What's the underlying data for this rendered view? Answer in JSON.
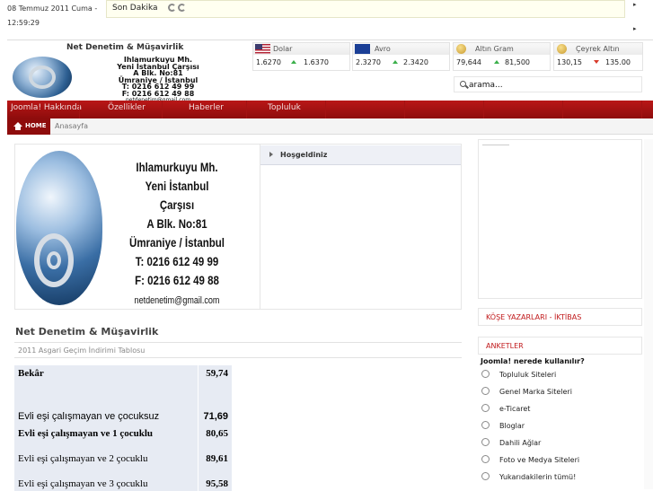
{
  "header": {
    "date": "08 Temmuz 2011 Cuma - 12:59:29",
    "news_label": "Son Dakika",
    "logo_title": "Net Denetim & Müşavirlik",
    "logo_lines": [
      "Ihlamurkuyu Mh.",
      "Yeni İstanbul Çarşısı",
      "A Blk. No:81",
      "Ümraniye / İstanbul",
      "T: 0216 612 49 99",
      "F: 0216 612 49 88",
      "netdenetim@gmail.com"
    ]
  },
  "currency": [
    {
      "name": "Dolar",
      "buy": "1.6270",
      "sell": "1.6370",
      "trend": "up",
      "icon": "us-flag-icon"
    },
    {
      "name": "Avro",
      "buy": "2.3270",
      "sell": "2.3420",
      "trend": "up",
      "icon": "eu-flag-icon"
    },
    {
      "name": "Altın Gram",
      "buy": "79,644",
      "sell": "81,500",
      "trend": "up",
      "icon": "gold-coin-icon"
    },
    {
      "name": "Çeyrek Altın",
      "buy": "130,15",
      "sell": "135.00",
      "trend": "down",
      "icon": "gold-coin-icon"
    }
  ],
  "search": {
    "value": "arama..."
  },
  "menu": [
    "Joomla! Hakkında",
    "Özellikler",
    "Haberler",
    "Topluluk"
  ],
  "breadcrumb": {
    "home": "HOME",
    "current": "Anasayfa"
  },
  "main": {
    "card": {
      "lines": [
        "Ihlamurkuyu Mh.",
        "Yeni İstanbul Çarşısı",
        "A Blk. No:81",
        "Ümraniye / İstanbul",
        "T: 0216 612 49 99",
        "F: 0216 612 49 88"
      ],
      "email": "netdenetim@gmail.com"
    },
    "welcome": "Hoşgeldiniz",
    "article_title": "Net Denetim & Müşavirlik",
    "article_subtitle": "2011 Asgari Geçim İndirimi Tablosu",
    "table": [
      {
        "label": "Bekâr",
        "value": "59,74"
      },
      {
        "label": "Evli eşi çalışmayan ve çocuksuz",
        "value": "71,69"
      },
      {
        "label": "Evli eşi çalışmayan ve 1 çocuklu",
        "value": "80,65"
      },
      {
        "label": "Evli eşi çalışmayan ve 2 çocuklu",
        "value": "89,61"
      },
      {
        "label": "Evli eşi çalışmayan ve 3 çocuklu",
        "value": "95,58"
      }
    ]
  },
  "sidebar": {
    "kose": "KÖŞE YAZARLARI - İKTİBAS",
    "anketler": "ANKETLER",
    "question": "Joomla! nerede kullanılır?",
    "options": [
      "Topluluk Siteleri",
      "Genel Marka Siteleri",
      "e-Ticaret",
      "Bloglar",
      "Dahili Ağlar",
      "Foto ve Medya Siteleri",
      "Yukarıdakilerin tümü!"
    ]
  },
  "colors": {
    "menu": "#a31212",
    "accent_text": "#c0181a",
    "up": "#3bb04a",
    "down": "#d83a2a"
  }
}
